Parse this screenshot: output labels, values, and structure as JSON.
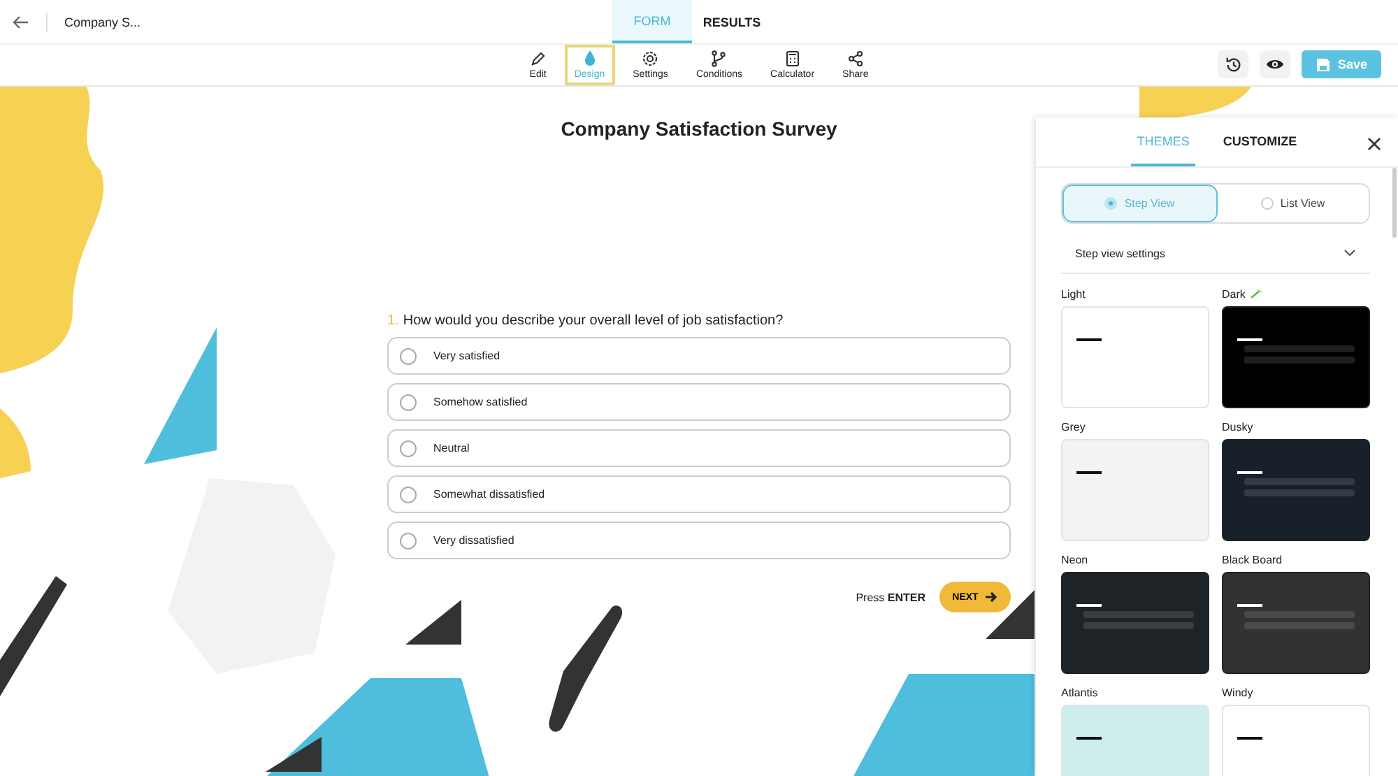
{
  "header": {
    "title": "Company S...",
    "tabs": [
      {
        "label": "FORM",
        "selected": true
      },
      {
        "label": "RESULTS",
        "selected": false
      }
    ]
  },
  "toolbar": [
    {
      "kind": "edit",
      "label": "Edit",
      "selected": false
    },
    {
      "kind": "design",
      "label": "Design",
      "selected": true
    },
    {
      "kind": "settings",
      "label": "Settings",
      "selected": false
    },
    {
      "kind": "conditions",
      "label": "Conditions",
      "selected": false
    },
    {
      "kind": "calculator",
      "label": "Calculator",
      "selected": false
    },
    {
      "kind": "share",
      "label": "Share",
      "selected": false
    }
  ],
  "save_button": "Save",
  "form": {
    "title": "Company Satisfaction Survey",
    "question_number": "1.",
    "question": "How would you describe your overall level of job satisfaction?",
    "options": [
      {
        "label": "Very satisfied",
        "selected": false
      },
      {
        "label": "Somehow satisfied",
        "selected": false
      },
      {
        "label": "Neutral",
        "selected": false
      },
      {
        "label": "Somewhat dissatisfied",
        "selected": false
      },
      {
        "label": "Very dissatisfied",
        "selected": false
      }
    ],
    "hint": "Press **ENTER**",
    "next_button": "NEXT"
  },
  "panel": {
    "tabs": [
      {
        "label": "THEMES",
        "selected": true
      },
      {
        "label": "CUSTOMIZE",
        "selected": false
      }
    ],
    "views": [
      {
        "label": "Step View",
        "selected": true
      },
      {
        "label": "List View",
        "selected": false
      }
    ],
    "settings_dropdown": "Step view settings",
    "themes": [
      {
        "name": "Light",
        "color": "#ffffff",
        "kind": "light",
        "flagged": false
      },
      {
        "name": "Dark",
        "color": "#000000",
        "kind": "dark",
        "flagged": true
      },
      {
        "name": "Grey",
        "color": "#f3f3f3",
        "kind": "light",
        "flagged": false
      },
      {
        "name": "Dusky",
        "color": "#18202b",
        "kind": "dark",
        "flagged": false
      },
      {
        "name": "Neon",
        "color": "#1d2326",
        "kind": "dark",
        "flagged": false
      },
      {
        "name": "Black Board",
        "color": "#333230",
        "kind": "dark",
        "flagged": false
      },
      {
        "name": "Atlantis",
        "color": "#cdeeea",
        "kind": "light",
        "flagged": false
      },
      {
        "name": "Windy",
        "color": "#ffffff",
        "kind": "light",
        "flagged": false
      }
    ]
  }
}
